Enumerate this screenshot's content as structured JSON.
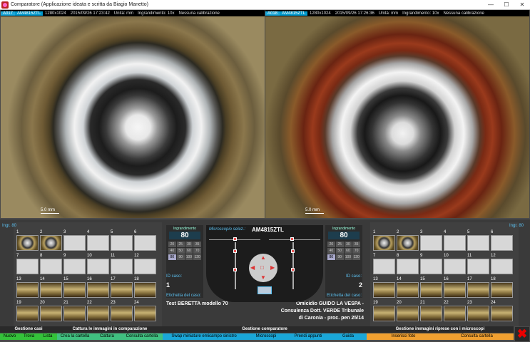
{
  "window": {
    "title": "Comparatore (Applicazione ideata e scritta da Biagio Manetto)",
    "btn_min": "—",
    "btn_max": "☐",
    "btn_close": "✕"
  },
  "left_panel": {
    "tag": "A017",
    "camera": "AM4815ZTL",
    "res": "1280x1024",
    "datetime": "2015/09/26 17:23:42",
    "units": "Unità: mm",
    "magnif": "Ingrandimento: 10x",
    "calib": "Nessuna calibrazione",
    "scale": "5.0 mm"
  },
  "right_panel": {
    "tag": "A018",
    "camera": "AM4815ZTL",
    "res": "1280x1024",
    "datetime": "2015/09/26 17:26:36",
    "units": "Unità: mm",
    "magnif": "Ingrandimento: 10x",
    "calib": "Nessuna calibrazione",
    "scale": "5.0 mm"
  },
  "left_ingr": "Ingr. 80",
  "right_ingr": "Ingr. 80",
  "thumb_numbers": [
    "1",
    "2",
    "3",
    "4",
    "5",
    "6",
    "7",
    "8",
    "9",
    "10",
    "11",
    "12",
    "13",
    "14",
    "15",
    "16",
    "17",
    "18",
    "19",
    "20",
    "21",
    "22",
    "23",
    "24"
  ],
  "ingrandimento": {
    "label": "Ingrandimento",
    "value": "80",
    "values": [
      "20",
      "25",
      "30",
      "35",
      "40",
      "50",
      "60",
      "70",
      "80",
      "90",
      "100",
      "120"
    ],
    "selected": "80"
  },
  "left_case": {
    "id_label": "ID caso:",
    "id": "1",
    "etichetta_label": "Etichetta del caso:",
    "text": "Test BERETTA modello 70"
  },
  "right_case": {
    "id_label": "ID caso:",
    "id": "2",
    "etichetta_label": "Etichetta del caso:",
    "text_lines": [
      "Omicidio GUIDO LA VESPA -",
      "Consulenza Dott. VERDE Tribunale",
      "di Caronia - proc. pen 25/14"
    ]
  },
  "center": {
    "msel": "Microscopio selez.:",
    "model": "AM4815ZTL",
    "arrow_up": "▲",
    "arrow_down": "▼",
    "arrow_left": "◀",
    "arrow_right": "▶",
    "center_sym": "□"
  },
  "footer": {
    "gestione_casi": "Gestione casi",
    "nuovo": "Nuovo",
    "trova": "Trova",
    "lista": "Lista",
    "cattura_header": "Cattura le immagini in comparazione",
    "crea_cartella": "Crea la cartella",
    "cattura": "Cattura",
    "consulta_cartella": "Consulta cartella",
    "comparatore_header": "Gestione comparatore",
    "swap": "Swap miniature emicampo sinistro",
    "microscopi": "Microscopi",
    "prendi_appunti": "Prendi appunti",
    "guida": "Guida",
    "immagini_header": "Gestione immagini riprese con i microscopi",
    "inserisci_foto": "Inserisci foto",
    "consulta_cartella2": "Consulta cartella",
    "close": "✖"
  },
  "colors": {
    "accent": "#1aa7d8",
    "green": "#34c23a",
    "orange": "#f0a030"
  }
}
